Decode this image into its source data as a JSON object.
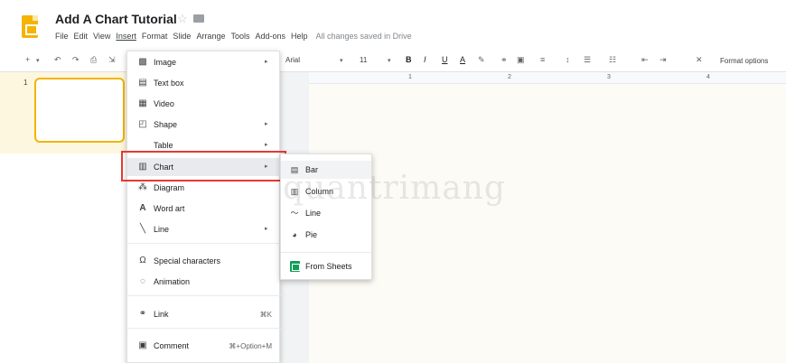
{
  "doc": {
    "title": "Add A Chart Tutorial",
    "star_icon": "star-icon",
    "folder_icon": "folder-icon"
  },
  "menubar": {
    "items": [
      "File",
      "Edit",
      "View",
      "Insert",
      "Format",
      "Slide",
      "Arrange",
      "Tools",
      "Add-ons",
      "Help"
    ],
    "saved_status": "All changes saved in Drive"
  },
  "toolbar": {
    "font": "Arial",
    "size": "11",
    "format_options": "Format options",
    "buttons": [
      "+",
      "▾",
      "↶",
      "↷",
      "⎙",
      "⇲"
    ],
    "text_buttons": [
      "B",
      "I",
      "U",
      "A"
    ]
  },
  "ruler": {
    "ticks": [
      "1",
      "2",
      "3",
      "4"
    ]
  },
  "filmstrip": {
    "slide_number": "1"
  },
  "insert_menu": {
    "items": [
      {
        "label": "Image",
        "icon": "image-icon",
        "submenu": true
      },
      {
        "label": "Text box",
        "icon": "text-box-icon",
        "submenu": false
      },
      {
        "label": "Video",
        "icon": "video-icon",
        "submenu": false
      },
      {
        "label": "Shape",
        "icon": "shape-icon",
        "submenu": true
      },
      {
        "label": "Table",
        "icon": "",
        "submenu": true
      },
      {
        "label": "Chart",
        "icon": "chart-icon",
        "submenu": true
      },
      {
        "label": "Diagram",
        "icon": "diagram-icon",
        "submenu": false
      },
      {
        "label": "Word art",
        "icon": "word-art-icon",
        "submenu": false
      },
      {
        "label": "Line",
        "icon": "line-icon",
        "submenu": true
      },
      {
        "label": "Special characters",
        "icon": "omega-icon",
        "submenu": false
      },
      {
        "label": "Animation",
        "icon": "animation-icon",
        "submenu": false
      },
      {
        "label": "Link",
        "icon": "link-icon",
        "shortcut": "⌘K"
      },
      {
        "label": "Comment",
        "icon": "comment-icon",
        "shortcut": "⌘+Option+M"
      }
    ]
  },
  "chart_submenu": {
    "items": [
      {
        "label": "Bar",
        "icon": "bar-chart-icon"
      },
      {
        "label": "Column",
        "icon": "column-chart-icon"
      },
      {
        "label": "Line",
        "icon": "line-chart-icon"
      },
      {
        "label": "Pie",
        "icon": "pie-chart-icon"
      },
      {
        "label": "From Sheets",
        "icon": "sheets-icon"
      }
    ]
  },
  "watermark": "quantrimang",
  "colors": {
    "accent": "#f4b400",
    "highlight": "#e53935",
    "sheets": "#0f9d58"
  }
}
